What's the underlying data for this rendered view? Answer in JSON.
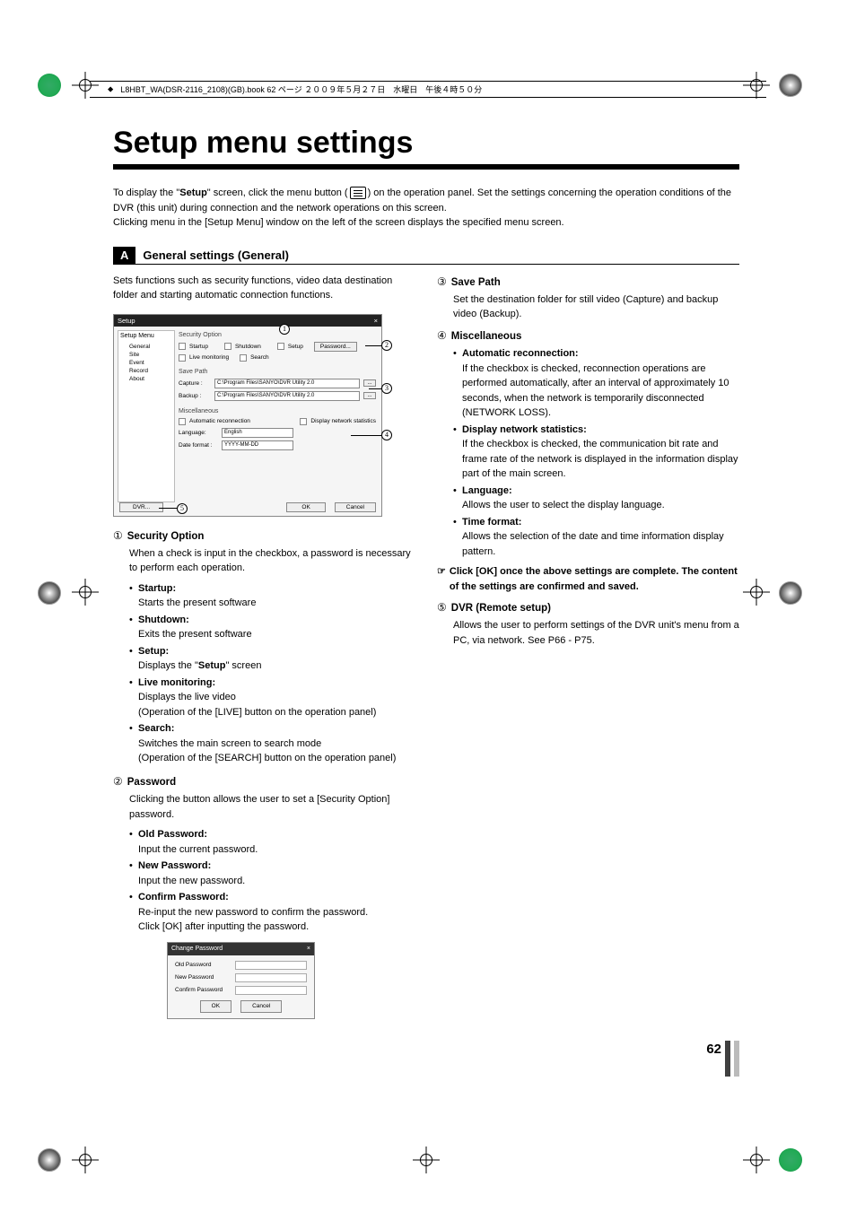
{
  "header_ribbon": "L8HBT_WA(DSR-2116_2108)(GB).book  62 ページ  ２００９年５月２７日　水曜日　午後４時５０分",
  "page_title": "Setup menu settings",
  "intro_p1_a": "To display the \"",
  "intro_p1_b": "Setup",
  "intro_p1_c": "\" screen, click the menu button (",
  "intro_p1_d": ") on the operation panel. Set the settings concerning the operation conditions of the DVR (this unit) during connection and the network operations on this screen.",
  "intro_p2": "Clicking menu in the [Setup Menu] window on the left of the screen displays the specified menu screen.",
  "sectionA": {
    "tag": "A",
    "title": "General settings (General)",
    "sub": "Sets functions such as security functions, video data destination folder and starting automatic connection functions."
  },
  "screenshot": {
    "win_title": "Setup",
    "close_x": "×",
    "menu_title": "Setup Menu",
    "menu_items": [
      "General",
      "Site",
      "Event",
      "Record",
      "About"
    ],
    "group_security": "Security Option",
    "chk_startup": "Startup",
    "chk_shutdown": "Shutdown",
    "chk_setup": "Setup",
    "btn_password": "Password...",
    "chk_live": "Live monitoring",
    "chk_search": "Search",
    "group_save": "Save Path",
    "lbl_capture": "Capture :",
    "lbl_backup": "Backup :",
    "path_value": "C:\\Program Files\\SANYO\\DVR Utility 2.0",
    "browse": "...",
    "group_misc": "Miscellaneous",
    "chk_autoreconn": "Automatic reconnection",
    "chk_netstat": "Display network statistics",
    "lbl_language": "Language:",
    "val_language": "English",
    "lbl_dateformat": "Date format :",
    "val_dateformat": "YYYY-MM-DD",
    "btn_dvr": "DVR...",
    "btn_ok": "OK",
    "btn_cancel": "Cancel"
  },
  "callouts": {
    "c1": "1",
    "c2": "2",
    "c3": "3",
    "c4": "4",
    "c5": "5"
  },
  "left": {
    "i1": {
      "n": "①",
      "t": "Security Option",
      "body": "When a check is input in the checkbox, a password is necessary to perform each operation."
    },
    "b_startup": {
      "t": "Startup:",
      "d": "Starts the present software"
    },
    "b_shutdown": {
      "t": "Shutdown:",
      "d": "Exits the present software"
    },
    "b_setup": {
      "t": "Setup:",
      "d_a": "Displays the \"",
      "d_b": "Setup",
      "d_c": "\" screen"
    },
    "b_live": {
      "t": "Live monitoring:",
      "d": "Displays the live video",
      "d2": "(Operation of the [LIVE] button on the operation panel)"
    },
    "b_search": {
      "t": "Search:",
      "d": "Switches the main screen to search mode",
      "d2": "(Operation of the [SEARCH] button on the operation panel)"
    },
    "i2": {
      "n": "②",
      "t": "Password",
      "body": "Clicking the button allows the user to set a [Security Option] password."
    },
    "b_oldpw": {
      "t": "Old Password:",
      "d": "Input the current password."
    },
    "b_newpw": {
      "t": "New Password:",
      "d": "Input the new password."
    },
    "b_confpw": {
      "t": "Confirm Password:",
      "d": "Re-input the new password to confirm the password.",
      "d2": "Click [OK] after inputting the password."
    }
  },
  "pw_dialog": {
    "title": "Change Password",
    "close_x": "×",
    "old": "Old Password",
    "new": "New Password",
    "confirm": "Confirm Password",
    "ok": "OK",
    "cancel": "Cancel"
  },
  "right": {
    "i3": {
      "n": "③",
      "t": "Save Path",
      "body": "Set the destination folder for still video (Capture) and backup video (Backup)."
    },
    "i4": {
      "n": "④",
      "t": "Miscellaneous"
    },
    "b_auto": {
      "t": "Automatic reconnection:",
      "d": "If the checkbox is checked, reconnection operations are performed automatically, after an interval of approximately 10 seconds, when the network is temporarily disconnected (NETWORK LOSS)."
    },
    "b_netstat": {
      "t": "Display network statistics:",
      "d": "If the checkbox is checked, the communication bit rate and frame rate of the network is displayed in the information display part of the main screen."
    },
    "b_lang": {
      "t": "Language:",
      "d": "Allows the user to select the display language."
    },
    "b_time": {
      "t": "Time format:",
      "d": "Allows the selection of the date and time information display pattern."
    },
    "note": {
      "icon": "☞",
      "text": "Click [OK] once the above settings are complete. The content of the settings are confirmed and saved."
    },
    "i5": {
      "n": "⑤",
      "t": "DVR (Remote setup)",
      "body": "Allows the user to perform settings of the DVR unit's menu from a PC, via network. See P66 - P75."
    }
  },
  "page_number": "62"
}
